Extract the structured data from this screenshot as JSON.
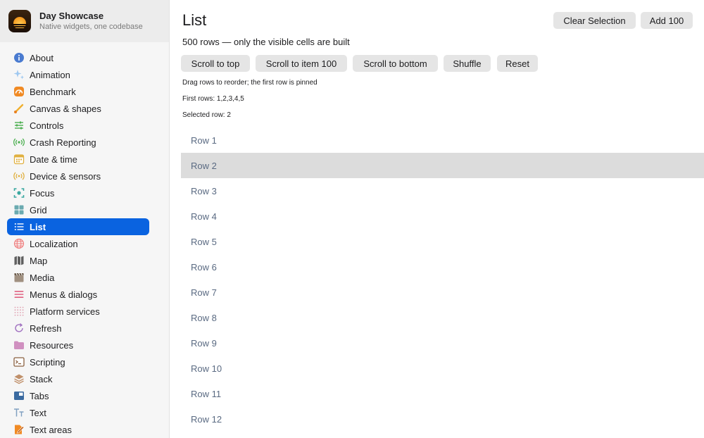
{
  "sidebar": {
    "app_title": "Day Showcase",
    "app_subtitle": "Native widgets, one codebase",
    "items": [
      {
        "label": "About",
        "icon": "info-icon",
        "color": "#4a7bd0"
      },
      {
        "label": "Animation",
        "icon": "sparkles-icon",
        "color": "#9ec8f0"
      },
      {
        "label": "Benchmark",
        "icon": "speedometer-icon",
        "color": "#f08a24"
      },
      {
        "label": "Canvas & shapes",
        "icon": "paintbrush-icon",
        "color": "#f0b030"
      },
      {
        "label": "Controls",
        "icon": "sliders-icon",
        "color": "#4caf50"
      },
      {
        "label": "Crash Reporting",
        "icon": "broadcast-icon",
        "color": "#4caf50"
      },
      {
        "label": "Date & time",
        "icon": "calendar-icon",
        "color": "#e0b040"
      },
      {
        "label": "Device & sensors",
        "icon": "sensor-icon",
        "color": "#e0b040"
      },
      {
        "label": "Focus",
        "icon": "focus-icon",
        "color": "#3aa8a0"
      },
      {
        "label": "Grid",
        "icon": "grid-icon",
        "color": "#6aaab0"
      },
      {
        "label": "List",
        "icon": "list-icon",
        "color": "#ffffff"
      },
      {
        "label": "Localization",
        "icon": "globe-icon",
        "color": "#f08080"
      },
      {
        "label": "Map",
        "icon": "map-icon",
        "color": "#606060"
      },
      {
        "label": "Media",
        "icon": "clapperboard-icon",
        "color": "#a09080"
      },
      {
        "label": "Menus & dialogs",
        "icon": "menu-lines-icon",
        "color": "#e06080"
      },
      {
        "label": "Platform services",
        "icon": "dots-grid-icon",
        "color": "#e0a0b0"
      },
      {
        "label": "Refresh",
        "icon": "refresh-icon",
        "color": "#a070c0"
      },
      {
        "label": "Resources",
        "icon": "folder-icon",
        "color": "#d090c0"
      },
      {
        "label": "Scripting",
        "icon": "terminal-icon",
        "color": "#8a6040"
      },
      {
        "label": "Stack",
        "icon": "stack-icon",
        "color": "#c0906a"
      },
      {
        "label": "Tabs",
        "icon": "tabs-icon",
        "color": "#3a6aa0"
      },
      {
        "label": "Text",
        "icon": "text-size-icon",
        "color": "#80a0c0"
      },
      {
        "label": "Text areas",
        "icon": "pencil-doc-icon",
        "color": "#f08a24"
      }
    ],
    "selected_index": 10
  },
  "main": {
    "title": "List",
    "clear_selection_label": "Clear Selection",
    "add_100_label": "Add 100",
    "subtitle": "500 rows — only the visible cells are built",
    "actions": {
      "scroll_top": "Scroll to top",
      "scroll_item_100": "Scroll to item 100",
      "scroll_bottom": "Scroll to bottom",
      "shuffle": "Shuffle",
      "reset": "Reset"
    },
    "hint": "Drag rows to reorder; the first row is pinned",
    "first_rows": "First rows: 1,2,3,4,5",
    "selected_row": "Selected row: 2",
    "rows": [
      "Row 1",
      "Row 2",
      "Row 3",
      "Row 4",
      "Row 5",
      "Row 6",
      "Row 7",
      "Row 8",
      "Row 9",
      "Row 10",
      "Row 11",
      "Row 12"
    ],
    "selected_row_index": 1
  },
  "colors": {
    "accent": "#0a63e0",
    "row_text": "#5a6a82",
    "selected_row_bg": "#dcdcdc"
  }
}
